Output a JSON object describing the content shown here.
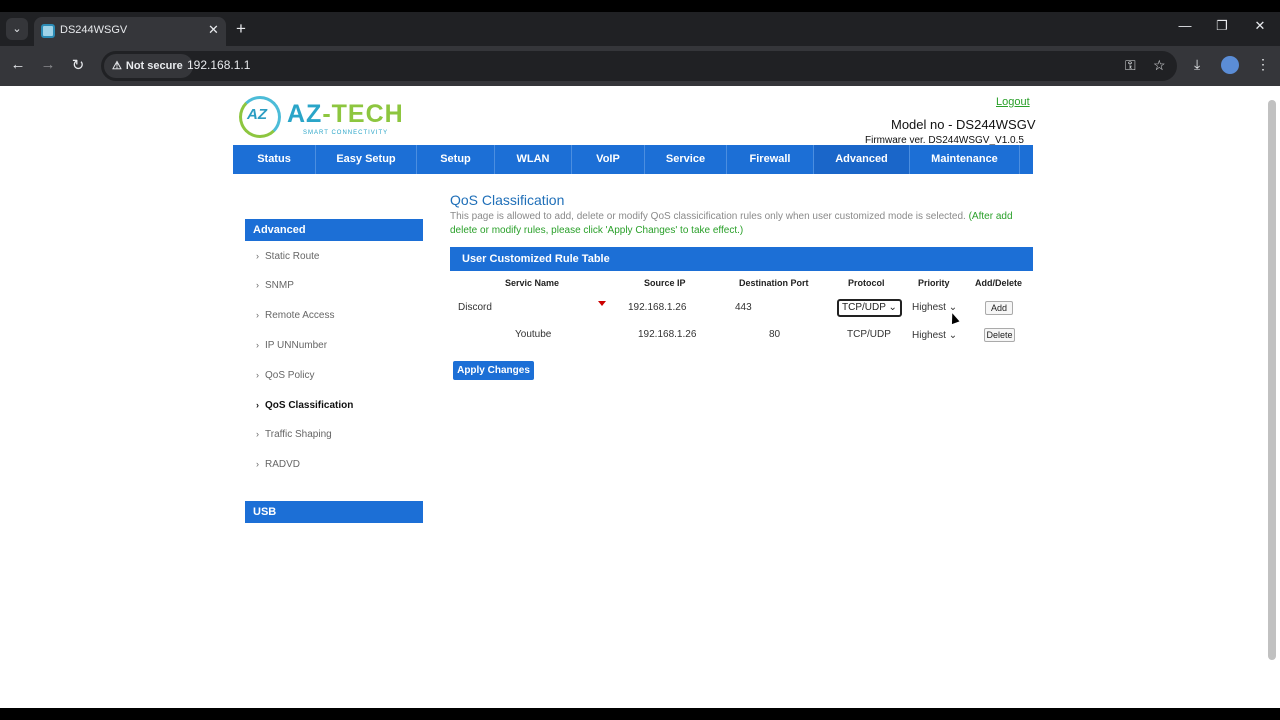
{
  "browser": {
    "tab_title": "DS244WSGV",
    "security_label": "Not secure",
    "url": "192.168.1.1"
  },
  "header": {
    "logo_text_a": "AZ",
    "logo_text_b": "-TECH",
    "logo_tagline": "SMART CONNECTIVITY",
    "logo_mark": "AZ",
    "logout": "Logout",
    "model": "Model no - DS244WSGV",
    "firmware": "Firmware ver. DS244WSGV_V1.0.5"
  },
  "topnav": {
    "items": [
      "Status",
      "Easy Setup",
      "Setup",
      "WLAN",
      "VoIP",
      "Service",
      "Firewall",
      "Advanced",
      "Maintenance"
    ],
    "active": "Advanced"
  },
  "sidebar": {
    "section_advanced": "Advanced",
    "items": [
      "Static Route",
      "SNMP",
      "Remote Access",
      "IP UNNumber",
      "QoS Policy",
      "QoS Classification",
      "Traffic Shaping",
      "RADVD"
    ],
    "current": "QoS Classification",
    "section_usb": "USB"
  },
  "content": {
    "title": "QoS Classification",
    "description": "This page is allowed to add, delete or modify QoS classicification rules only when user customized mode is selected.",
    "note": "(After add delete or modify rules, please click 'Apply Changes' to take effect.)",
    "table_title": "User Customized Rule Table",
    "columns": {
      "service": "Servic Name",
      "source_ip": "Source IP",
      "dest_port": "Destination Port",
      "protocol": "Protocol",
      "priority": "Priority",
      "action": "Add/Delete"
    },
    "new_rule": {
      "service": "Discord",
      "source_ip": "192.168.1.26",
      "dest_port": "443",
      "protocol": "TCP/UDP",
      "priority": "Highest",
      "action": "Add"
    },
    "existing_rule": {
      "service": "Youtube",
      "source_ip": "192.168.1.26",
      "dest_port": "80",
      "protocol": "TCP/UDP",
      "priority": "Highest",
      "action": "Delete"
    },
    "apply_label": "Apply Changes"
  }
}
